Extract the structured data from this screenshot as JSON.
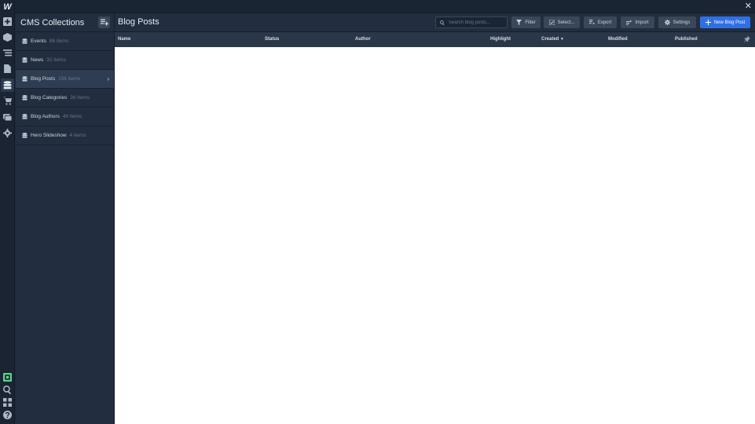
{
  "rail": {
    "logo": "W",
    "icons": [
      "add-panel-icon",
      "cube-icon",
      "navigator-icon",
      "pages-icon",
      "cms-database-icon",
      "ecommerce-cart-icon",
      "assets-icon",
      "settings-gear-icon",
      "audit-icon",
      "search-icon",
      "apps-icon",
      "help-icon"
    ]
  },
  "topbar": {
    "close": "✕"
  },
  "collections_panel": {
    "title": "CMS Collections",
    "items": [
      {
        "name": "Events",
        "count": "86 items"
      },
      {
        "name": "News",
        "count": "32 items"
      },
      {
        "name": "Blog Posts",
        "count": "156 items"
      },
      {
        "name": "Blog Categories",
        "count": "38 items"
      },
      {
        "name": "Blog Authors",
        "count": "40 items"
      },
      {
        "name": "Hero Slideshow",
        "count": "4 items"
      }
    ],
    "selected": "Blog Posts"
  },
  "main": {
    "title": "Blog Posts",
    "search": {
      "placeholder": "Search blog posts...",
      "value": ""
    },
    "toolbar": {
      "filter": "Filter",
      "select": "Select...",
      "export": "Export",
      "import": "Import",
      "settings": "Settings",
      "new_item": "New Blog Post"
    },
    "columns": [
      "Name",
      "Status",
      "Author",
      "Highlight",
      "Created",
      "Modified",
      "Published"
    ],
    "sort_column": "Created",
    "rows": []
  },
  "colors": {
    "accent": "#2f6fe4",
    "panel_bg": "#222e3f",
    "rail_bg": "#1a2433"
  }
}
